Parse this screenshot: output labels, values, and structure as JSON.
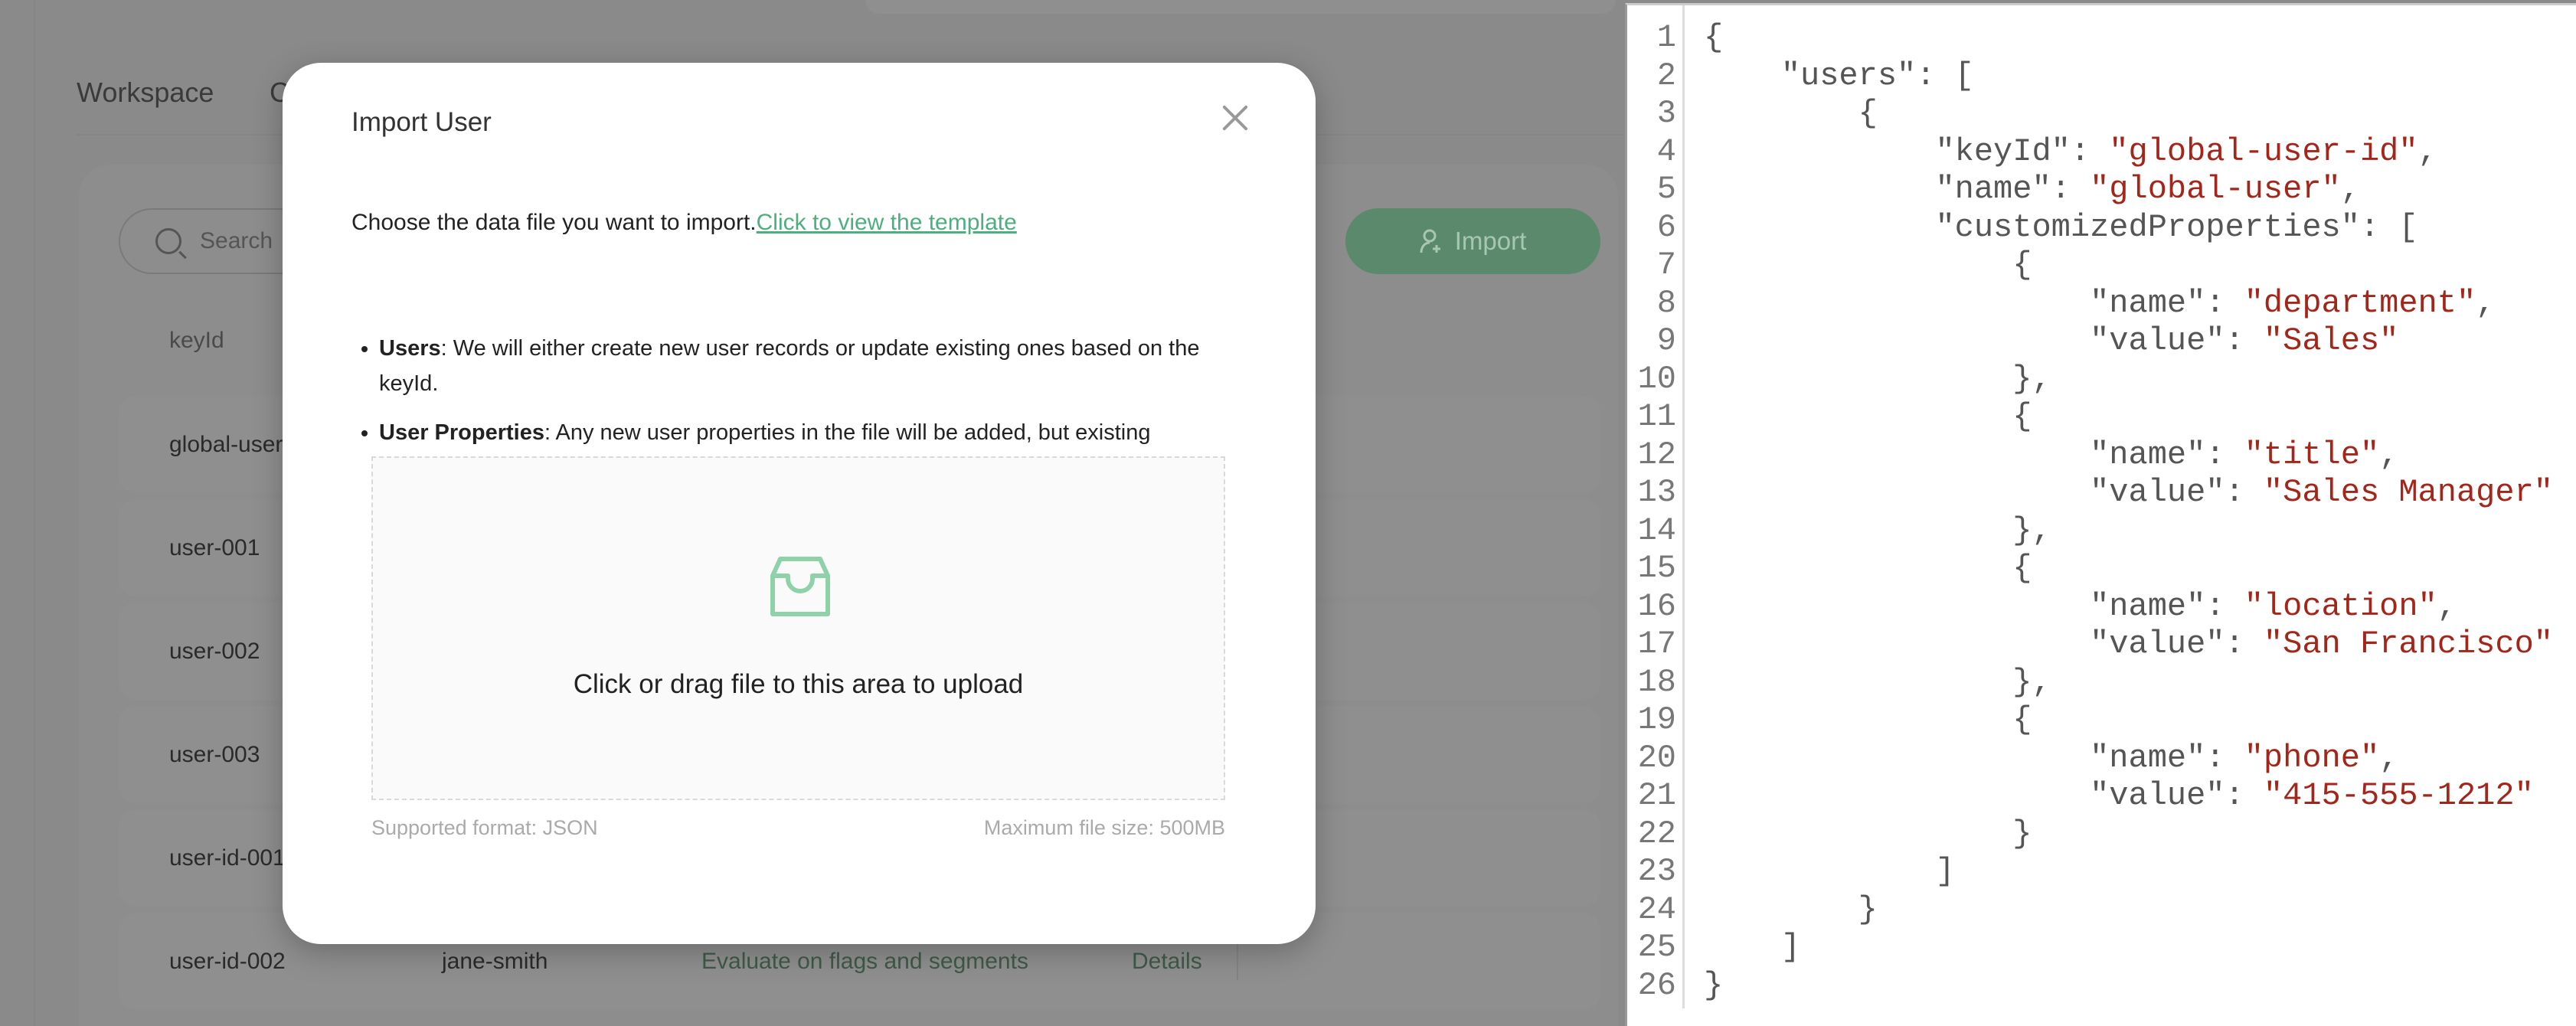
{
  "app": {
    "tabs": [
      {
        "label": "Workspace"
      },
      {
        "label": "C"
      }
    ],
    "search_placeholder": "Search",
    "import_button": "Import",
    "table": {
      "columns": [
        "keyId"
      ],
      "rows": [
        {
          "keyId": "global-user"
        },
        {
          "keyId": "user-001"
        },
        {
          "keyId": "user-002"
        },
        {
          "keyId": "user-003"
        },
        {
          "keyId": "user-id-001"
        },
        {
          "keyId": "user-id-002",
          "name": "jane-smith",
          "action": "Evaluate on flags and segments",
          "details": "Details"
        }
      ]
    },
    "colors": {
      "accent": "#4caf7d"
    }
  },
  "modal": {
    "title": "Import User",
    "intro": "Choose the data file you want to import.",
    "template_link": "Click to view the template",
    "bullets": [
      {
        "bold": "Users",
        "text": ": We will either create new user records or update existing ones based on the keyId."
      },
      {
        "bold": "User Properties",
        "text": ": Any new user properties in the file will be added, but existing properties will not be changed."
      }
    ],
    "upload_icon": "inbox-icon",
    "upload_text": "Click or drag file to this area to upload",
    "supported_format": "Supported format: JSON",
    "max_size": "Maximum file size: 500MB"
  },
  "code": {
    "string_color": "#a3261b",
    "lines": [
      "{",
      "    \"users\": [",
      "        {",
      "            \"keyId\": \"global-user-id\",",
      "            \"name\": \"global-user\",",
      "            \"customizedProperties\": [",
      "                {",
      "                    \"name\": \"department\",",
      "                    \"value\": \"Sales\"",
      "                },",
      "                {",
      "                    \"name\": \"title\",",
      "                    \"value\": \"Sales Manager\"",
      "                },",
      "                {",
      "                    \"name\": \"location\",",
      "                    \"value\": \"San Francisco\"",
      "                },",
      "                {",
      "                    \"name\": \"phone\",",
      "                    \"value\": \"415-555-1212\"",
      "                }",
      "            ]",
      "        }",
      "    ]",
      "}"
    ]
  }
}
